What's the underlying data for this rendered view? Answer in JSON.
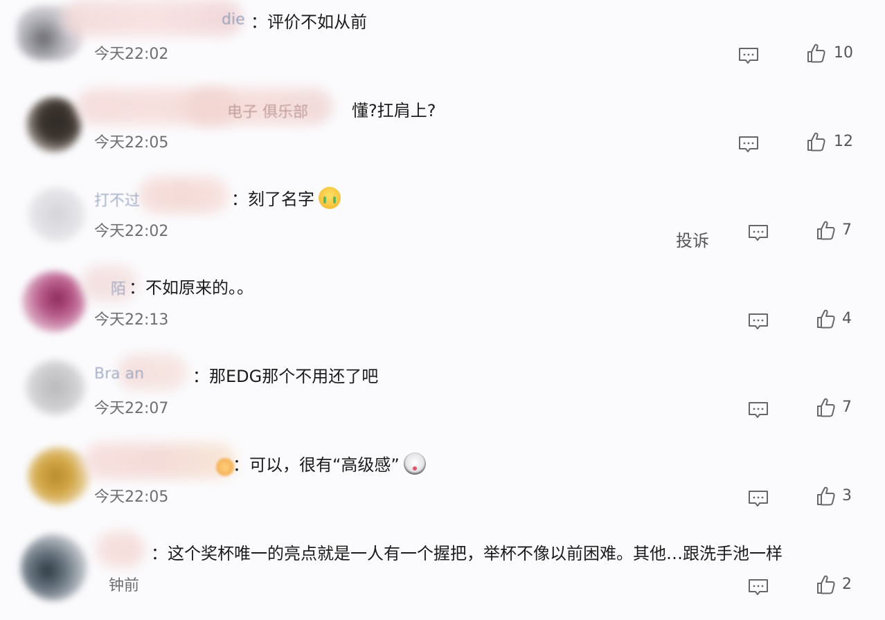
{
  "comments": [
    {
      "name_tail": "die",
      "sep": "：",
      "text": "评价不如从前",
      "time": "今天22:02",
      "likes": "10",
      "report": ""
    },
    {
      "name_tail": "电子    俱乐部",
      "sep": "",
      "text": "懂?扛肩上?",
      "time": "今天22:05",
      "likes": "12",
      "report": ""
    },
    {
      "name_tail": "打不过",
      "sep": "：",
      "text": "刻了名字",
      "time": "今天22:02",
      "likes": "7",
      "report": "投诉"
    },
    {
      "name_tail": "陌",
      "sep": "：",
      "text": "不如原来的。。",
      "time": "今天22:13",
      "likes": "4",
      "report": ""
    },
    {
      "name_tail": "Bra      an",
      "sep": "：",
      "text": "那EDG那个不用还了吧",
      "time": "今天22:07",
      "likes": "7",
      "report": ""
    },
    {
      "name_tail": "",
      "sep": "：",
      "text": "可以，很有“高级感”",
      "time": "今天22:05",
      "likes": "3",
      "report": ""
    },
    {
      "name_tail": "",
      "sep": "：",
      "text": "这个奖杯唯一的亮点就是一人有一个握把，举杯不像以前困难。其他…跟洗手池一样",
      "time": "   钟前",
      "likes": "2",
      "report": ""
    }
  ]
}
